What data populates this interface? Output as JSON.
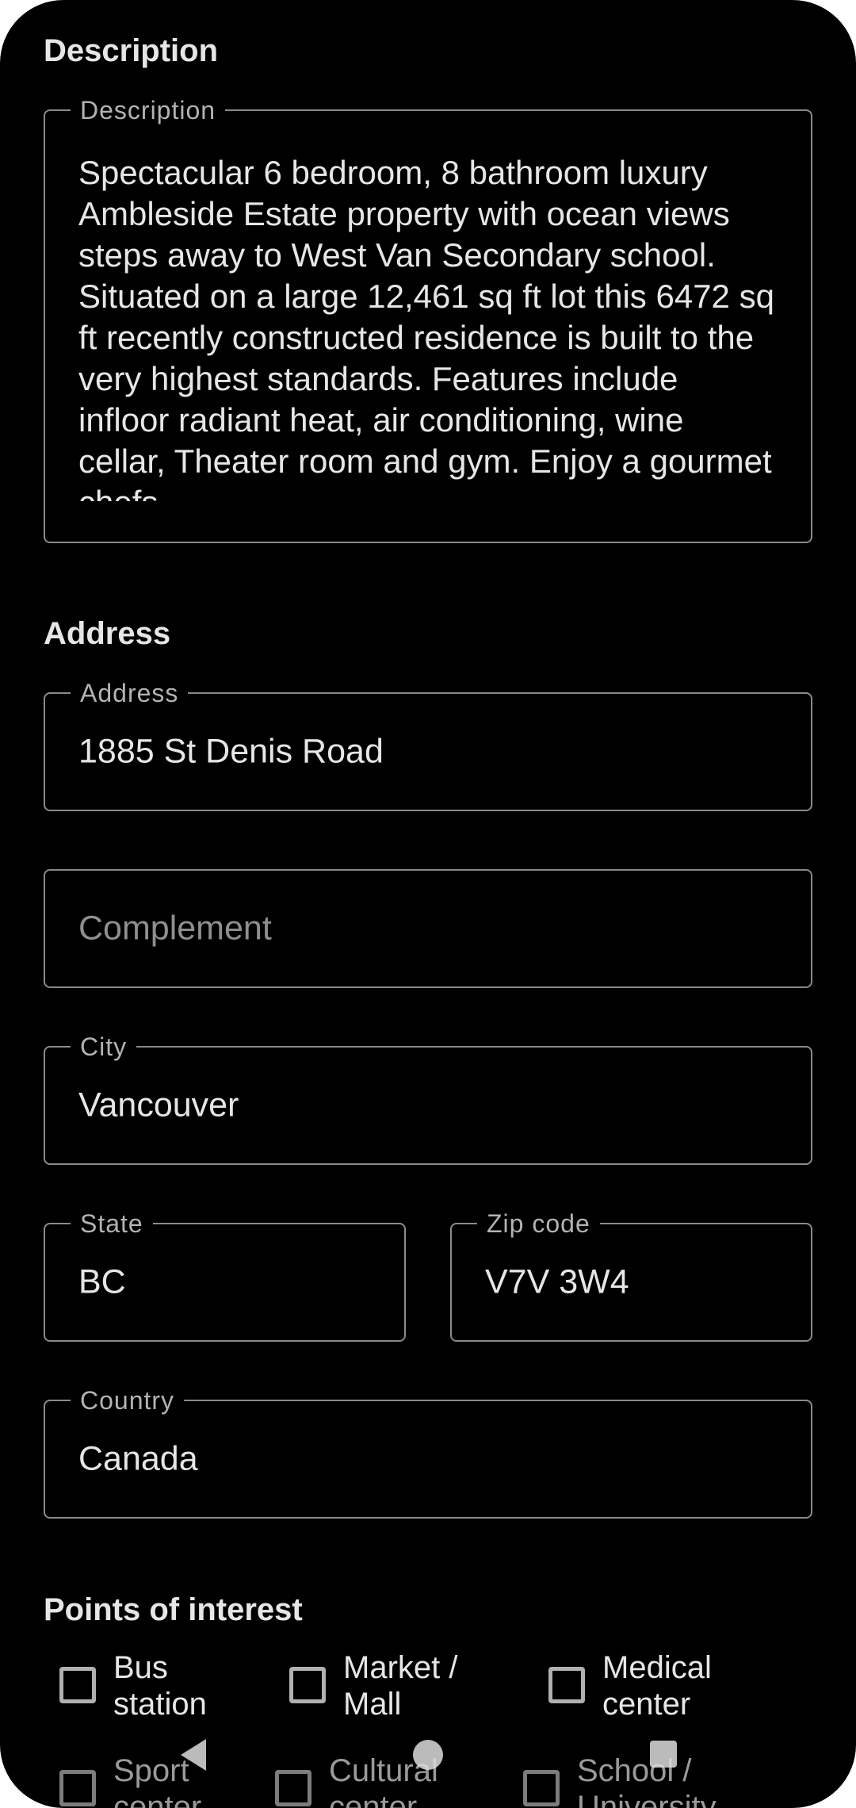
{
  "description_section": {
    "title": "Description",
    "field_label": "Description",
    "value": "Spectacular 6 bedroom, 8 bathroom luxury Ambleside Estate property with ocean views steps away to West Van Secondary school. Situated on a large 12,461 sq ft lot this 6472 sq ft recently constructed residence is built to the very highest standards. Features include infloor radiant heat, air conditioning, wine cellar, Theater room and gym. Enjoy a gourmet chefs"
  },
  "address_section": {
    "title": "Address",
    "address": {
      "label": "Address",
      "value": "1885 St Denis Road"
    },
    "complement": {
      "placeholder": "Complement"
    },
    "city": {
      "label": "City",
      "value": "Vancouver"
    },
    "state": {
      "label": "State",
      "value": "BC"
    },
    "zip": {
      "label": "Zip code",
      "value": "V7V 3W4"
    },
    "country": {
      "label": "Country",
      "value": "Canada"
    }
  },
  "poi_section": {
    "title": "Points of interest",
    "items": [
      {
        "label": "Bus station",
        "checked": false
      },
      {
        "label": "Market / Mall",
        "checked": false
      },
      {
        "label": "Medical center",
        "checked": false
      },
      {
        "label": "Sport center",
        "checked": false
      },
      {
        "label": "Cultural center",
        "checked": false
      },
      {
        "label": "School / University",
        "checked": false
      }
    ]
  },
  "navigation": {
    "back_icon": "back-triangle-icon",
    "home_icon": "home-circle-icon",
    "recents_icon": "recents-square-icon"
  }
}
